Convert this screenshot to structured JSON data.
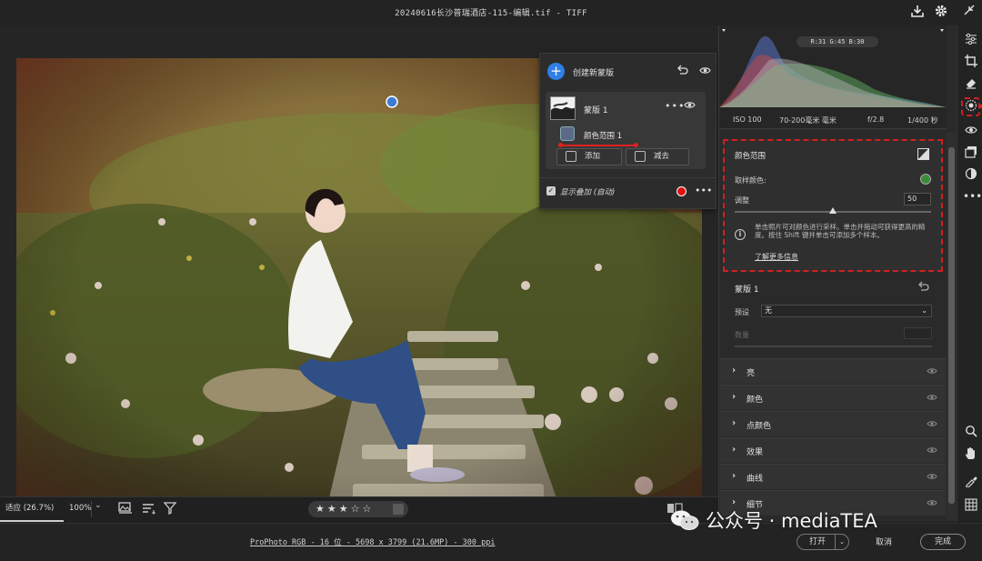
{
  "window": {
    "title": "20240616长沙普瑞酒店-115-编辑.tif -  TIFF"
  },
  "mask_panel": {
    "create_new_mask": "创建新蒙版",
    "mask_name": "蒙版 1",
    "sub_mask_name": "颜色范围 1",
    "add_label": "添加",
    "subtract_label": "减去",
    "show_overlay_label": "显示叠加 (自动)",
    "overlay_color": "#e01010"
  },
  "histogram": {
    "readout": "R:31  G:45  B:30",
    "exif": {
      "iso": "ISO 100",
      "lens": "70-200毫米 毫米",
      "aperture": "f/2.8",
      "shutter": "1/400 秒"
    }
  },
  "color_range": {
    "title": "颜色范围",
    "sample_label": "取样颜色:",
    "sample_color": "#3e8a3c",
    "adjust_label": "调整",
    "adjust_value": "50",
    "adjust_fraction": 0.5,
    "tip": "单击照片可对颜色进行采样。单击并拖动可获得更高的精度。按住 Shift 键并单击可添加多个样本。",
    "learn_more": "了解更多信息"
  },
  "mask1": {
    "title": "蒙版 1",
    "preset_label": "预设",
    "preset_value": "无",
    "amount_label": "数量"
  },
  "sections": [
    {
      "label": "亮"
    },
    {
      "label": "颜色"
    },
    {
      "label": "点颜色"
    },
    {
      "label": "效果"
    },
    {
      "label": "曲线"
    },
    {
      "label": "细节"
    }
  ],
  "bottom_bar": {
    "fit_label": "适应 (26.7%)",
    "zoom_label": "100%",
    "rating_stars": "★★★☆☆",
    "rating": 3
  },
  "status_bar": {
    "info": "ProPhoto RGB - 16 位 - 5698 x 3799 (21.6MP) - 300 ppi",
    "open_label": "打开",
    "cancel_label": "取消",
    "done_label": "完成"
  },
  "watermark": {
    "text": "公众号 · mediaTEA"
  },
  "accent": {
    "blue": "#2f7fe6",
    "highlight_red": "#d21f1f"
  }
}
